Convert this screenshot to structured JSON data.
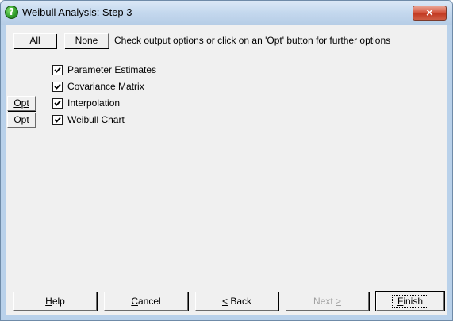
{
  "window": {
    "title": "Weibull Analysis: Step 3",
    "close_label": "×"
  },
  "toolbar": {
    "all_label": "All",
    "none_label": "None",
    "instruction": "Check output options or click on an 'Opt' button for further options"
  },
  "options": [
    {
      "label": "Parameter Estimates",
      "checked": true,
      "has_opt": false
    },
    {
      "label": "Covariance Matrix",
      "checked": true,
      "has_opt": false
    },
    {
      "label": "Interpolation",
      "checked": true,
      "has_opt": true,
      "opt_label": "Opt"
    },
    {
      "label": "Weibull Chart",
      "checked": true,
      "has_opt": true,
      "opt_label": "Opt"
    }
  ],
  "footer": {
    "help": {
      "mnemonic": "H",
      "rest": "elp"
    },
    "cancel": {
      "mnemonic": "C",
      "rest": "ancel"
    },
    "back": {
      "mnemonic": "<",
      "rest": " Back"
    },
    "next": {
      "pre": "Next ",
      "mnemonic": ">"
    },
    "finish": {
      "mnemonic": "F",
      "rest": "inish"
    }
  }
}
